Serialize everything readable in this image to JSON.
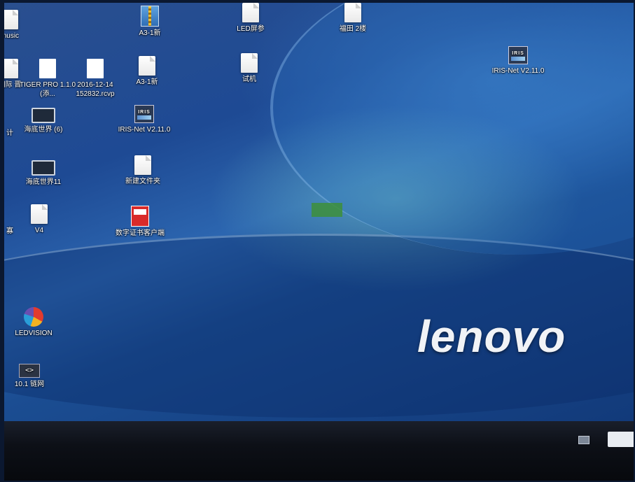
{
  "desktop": {
    "icons": [
      {
        "label": "music",
        "glyph": "folder-icon"
      },
      {
        "label": "A3-1新",
        "glyph": "archive-icon"
      },
      {
        "label": "LED屏参",
        "glyph": "folder-icon"
      },
      {
        "label": "福田 2楼",
        "glyph": "folder-icon"
      },
      {
        "label": "国际 晋",
        "glyph": "folder-icon"
      },
      {
        "label": "TIGER PRO 1.1.0 (添...",
        "glyph": "file-icon"
      },
      {
        "label": "2016-12-14 152832.rcvp",
        "glyph": "file-icon"
      },
      {
        "label": "A3-1新",
        "glyph": "folder-icon"
      },
      {
        "label": "试机",
        "glyph": "folder-icon"
      },
      {
        "label": "IRIS-Net V2.11.0",
        "glyph": "iris-net-icon"
      },
      {
        "label": "计",
        "glyph": "file-icon"
      },
      {
        "label": "海底世界 (6)",
        "glyph": "monitor-icon"
      },
      {
        "label": "IRIS-Net V2.11.0",
        "glyph": "iris-net-icon"
      },
      {
        "label": "海底世界11",
        "glyph": "monitor-icon"
      },
      {
        "label": "新建文件夹",
        "glyph": "folder-icon"
      },
      {
        "label": "寡",
        "glyph": "file-icon"
      },
      {
        "label": "V4",
        "glyph": "folder-icon"
      },
      {
        "label": "数字证书客户端",
        "glyph": "certificate-icon"
      },
      {
        "label": "LEDVISION",
        "glyph": "ledvision-icon"
      },
      {
        "label": "10.1 链网",
        "glyph": "network-shortcut-icon"
      }
    ],
    "iris_text": "IRIS",
    "wallpaper_logo": "lenovo"
  },
  "colors": {
    "wallpaper_base": "#1e4a94",
    "taskbar": "#0d1017",
    "logo": "#f1f3f6"
  }
}
